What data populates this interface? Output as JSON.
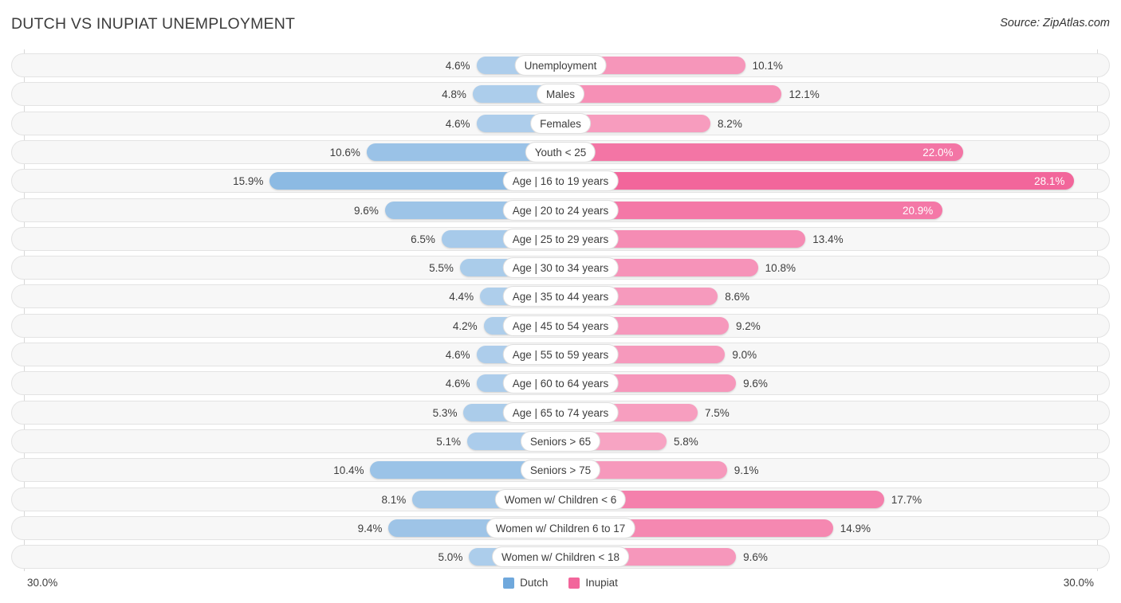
{
  "header": {
    "title": "DUTCH VS INUPIAT UNEMPLOYMENT",
    "source": "Source: ZipAtlas.com"
  },
  "axis": {
    "max_left_label": "30.0%",
    "max_right_label": "30.0%",
    "max_value": 30.0
  },
  "legend": {
    "items": [
      {
        "label": "Dutch",
        "color": "#6fa8dc"
      },
      {
        "label": "Inupiat",
        "color": "#f2669b"
      }
    ]
  },
  "colors": {
    "left_base": "#5b9bd5",
    "right_base": "#ec407a",
    "track_bg": "#f7f7f7",
    "track_border": "#e3e3e3",
    "axis_line": "#d8d8d8",
    "text": "#3d3d3d"
  },
  "chart_data": {
    "type": "bar",
    "subtype": "diverging-horizontal",
    "title": "DUTCH VS INUPIAT UNEMPLOYMENT",
    "xlabel": "",
    "ylabel": "",
    "unit": "%",
    "xlim": [
      30.0,
      30.0
    ],
    "grid": false,
    "legend_position": "bottom-center",
    "categories": [
      "Unemployment",
      "Males",
      "Females",
      "Youth < 25",
      "Age | 16 to 19 years",
      "Age | 20 to 24 years",
      "Age | 25 to 29 years",
      "Age | 30 to 34 years",
      "Age | 35 to 44 years",
      "Age | 45 to 54 years",
      "Age | 55 to 59 years",
      "Age | 60 to 64 years",
      "Age | 65 to 74 years",
      "Seniors > 65",
      "Seniors > 75",
      "Women w/ Children < 6",
      "Women w/ Children 6 to 17",
      "Women w/ Children < 18"
    ],
    "series": [
      {
        "name": "Dutch",
        "side": "left",
        "color": "#6fa8dc",
        "values": [
          4.6,
          4.8,
          4.6,
          10.6,
          15.9,
          9.6,
          6.5,
          5.5,
          4.4,
          4.2,
          4.6,
          4.6,
          5.3,
          5.1,
          10.4,
          8.1,
          9.4,
          5.0
        ],
        "labels": [
          "4.6%",
          "4.8%",
          "4.6%",
          "10.6%",
          "15.9%",
          "9.6%",
          "6.5%",
          "5.5%",
          "4.4%",
          "4.2%",
          "4.6%",
          "4.6%",
          "5.3%",
          "5.1%",
          "10.4%",
          "8.1%",
          "9.4%",
          "5.0%"
        ]
      },
      {
        "name": "Inupiat",
        "side": "right",
        "color": "#f2669b",
        "values": [
          10.1,
          12.1,
          8.2,
          22.0,
          28.1,
          20.9,
          13.4,
          10.8,
          8.6,
          9.2,
          9.0,
          9.6,
          7.5,
          5.8,
          9.1,
          17.7,
          14.9,
          9.6
        ],
        "labels": [
          "10.1%",
          "12.1%",
          "8.2%",
          "22.0%",
          "28.1%",
          "20.9%",
          "13.4%",
          "10.8%",
          "8.6%",
          "9.2%",
          "9.0%",
          "9.6%",
          "7.5%",
          "5.8%",
          "9.1%",
          "17.7%",
          "14.9%",
          "9.6%"
        ]
      }
    ]
  }
}
